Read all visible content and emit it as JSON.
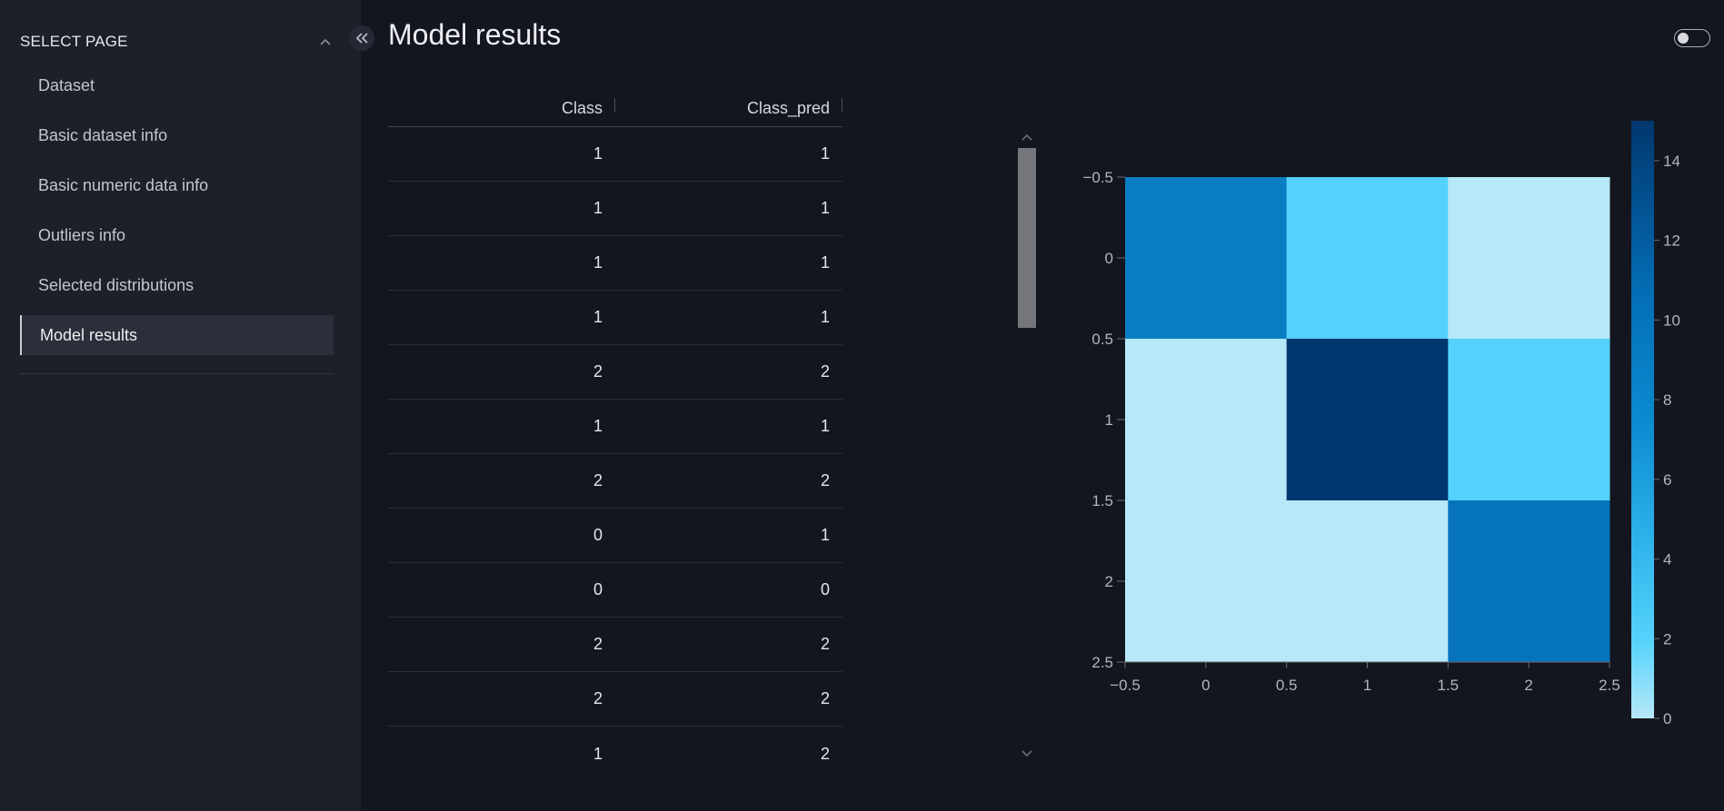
{
  "sidebar": {
    "title": "SELECT PAGE",
    "items": [
      {
        "label": "Dataset"
      },
      {
        "label": "Basic dataset info"
      },
      {
        "label": "Basic numeric data info"
      },
      {
        "label": "Outliers info"
      },
      {
        "label": "Selected distributions"
      },
      {
        "label": "Model results",
        "active": true
      }
    ]
  },
  "main": {
    "title": "Model results"
  },
  "table": {
    "columns": [
      "Class",
      "Class_pred"
    ],
    "rows": [
      [
        "1",
        "1"
      ],
      [
        "1",
        "1"
      ],
      [
        "1",
        "1"
      ],
      [
        "1",
        "1"
      ],
      [
        "2",
        "2"
      ],
      [
        "1",
        "1"
      ],
      [
        "2",
        "2"
      ],
      [
        "0",
        "1"
      ],
      [
        "0",
        "0"
      ],
      [
        "2",
        "2"
      ],
      [
        "2",
        "2"
      ],
      [
        "1",
        "2"
      ]
    ]
  },
  "icons": {
    "collapse_sidebar": "double-chevron-left-icon",
    "section_collapse": "chevron-up-icon",
    "scroll_up": "chevron-up-icon",
    "scroll_down": "chevron-down-icon"
  },
  "chart_data": {
    "type": "heatmap",
    "title": "",
    "xlabel": "",
    "ylabel": "",
    "matrix": [
      [
        9,
        2,
        0
      ],
      [
        0,
        15,
        2
      ],
      [
        0,
        0,
        10
      ]
    ],
    "x_ticks": [
      "−0.5",
      "0",
      "0.5",
      "1",
      "1.5",
      "2",
      "2.5"
    ],
    "y_ticks": [
      "−0.5",
      "0",
      "0.5",
      "1",
      "1.5",
      "2",
      "2.5"
    ],
    "xlim": [
      -0.5,
      2.5
    ],
    "ylim": [
      2.5,
      -0.5
    ],
    "colorbar": {
      "min": 0,
      "max": 15,
      "ticks": [
        "0",
        "2",
        "4",
        "6",
        "8",
        "10",
        "12",
        "14"
      ],
      "colorscale": "Blues"
    },
    "colors": {
      "low": "#b6e8f8",
      "mid_low": "#55d3fb",
      "mid": "#0b8ad0",
      "high": "#01376f"
    }
  }
}
